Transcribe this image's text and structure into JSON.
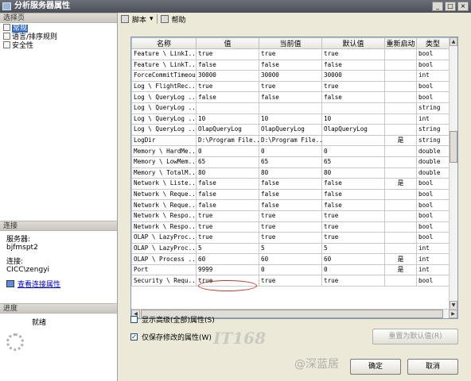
{
  "window": {
    "title": "分析服务器属性",
    "minimize": "_",
    "maximize": "□",
    "close": "×"
  },
  "left": {
    "select_page_header": "选择页",
    "pages": [
      {
        "label": "常规",
        "selected": true
      },
      {
        "label": "语言/排序规则",
        "selected": false
      },
      {
        "label": "安全性",
        "selected": false
      }
    ],
    "connection_header": "连接",
    "server_label": "服务器:",
    "server_value": "bjfmspt2",
    "connection_label": "连接:",
    "connection_value": "CICC\\zengyi",
    "view_connection_link": "查看连接属性",
    "progress_header": "进度",
    "progress_status": "就绪"
  },
  "toolbar": {
    "script_label": "脚本",
    "script_arrow": "▾",
    "help_label": "帮助"
  },
  "grid": {
    "columns": [
      "名称",
      "值",
      "当前值",
      "默认值",
      "重新启动",
      "类型"
    ],
    "rows": [
      [
        "Feature \\ LinkI...",
        "true",
        "true",
        "true",
        "",
        "bool"
      ],
      [
        "Feature \\ LinkT...",
        "false",
        "false",
        "false",
        "",
        "bool"
      ],
      [
        "ForceCommitTimeout",
        "30000",
        "30000",
        "30000",
        "",
        "int"
      ],
      [
        "Log \\ FlightRec...",
        "true",
        "true",
        "true",
        "",
        "bool"
      ],
      [
        "Log \\ QueryLog ...",
        "false",
        "false",
        "false",
        "",
        "bool"
      ],
      [
        "Log \\ QueryLog ...",
        "",
        "",
        "",
        "",
        "string"
      ],
      [
        "Log \\ QueryLog ...",
        "10",
        "10",
        "10",
        "",
        "int"
      ],
      [
        "Log \\ QueryLog ...",
        "OlapQueryLog",
        "OlapQueryLog",
        "OlapQueryLog",
        "",
        "string"
      ],
      [
        "LogDir",
        "D:\\Program File...",
        "D:\\Program File...",
        "",
        "是",
        "string"
      ],
      [
        "Memory \\ HardMe...",
        "0",
        "0",
        "0",
        "",
        "double"
      ],
      [
        "Memory \\ LowMem...",
        "65",
        "65",
        "65",
        "",
        "double"
      ],
      [
        "Memory \\ TotalM...",
        "80",
        "80",
        "80",
        "",
        "double"
      ],
      [
        "Network \\ Liste...",
        "false",
        "false",
        "false",
        "是",
        "bool"
      ],
      [
        "Network \\ Reque...",
        "false",
        "false",
        "false",
        "",
        "bool"
      ],
      [
        "Network \\ Reque...",
        "false",
        "false",
        "false",
        "",
        "bool"
      ],
      [
        "Network \\ Respo...",
        "true",
        "true",
        "true",
        "",
        "bool"
      ],
      [
        "Network \\ Respo...",
        "true",
        "true",
        "true",
        "",
        "bool"
      ],
      [
        "OLAP \\ LazyProc...",
        "true",
        "true",
        "true",
        "",
        "bool"
      ],
      [
        "OLAP \\ LazyProc...",
        "5",
        "5",
        "5",
        "",
        "int"
      ],
      [
        "OLAP \\ Process ...",
        "60",
        "60",
        "60",
        "是",
        "int"
      ],
      [
        "Port",
        "9999",
        "0",
        "0",
        "是",
        "int"
      ],
      [
        "Security \\ Requ...",
        "true",
        "true",
        "true",
        "",
        "bool"
      ]
    ],
    "scroll_up": "▲",
    "scroll_down": "▼",
    "scroll_left": "◀",
    "scroll_right": "▶"
  },
  "options": {
    "show_advanced": {
      "label": "显示高级(全部)属性(S)",
      "checked": false
    },
    "show_modified": {
      "label": "仅保存修改的属性(W)",
      "checked": true,
      "mark": "✓"
    }
  },
  "buttons": {
    "reset_default": "重置为默认值(R)",
    "ok": "确定",
    "cancel": "取消"
  },
  "watermarks": {
    "brand": "IT168",
    "site": "@深蓝居"
  }
}
